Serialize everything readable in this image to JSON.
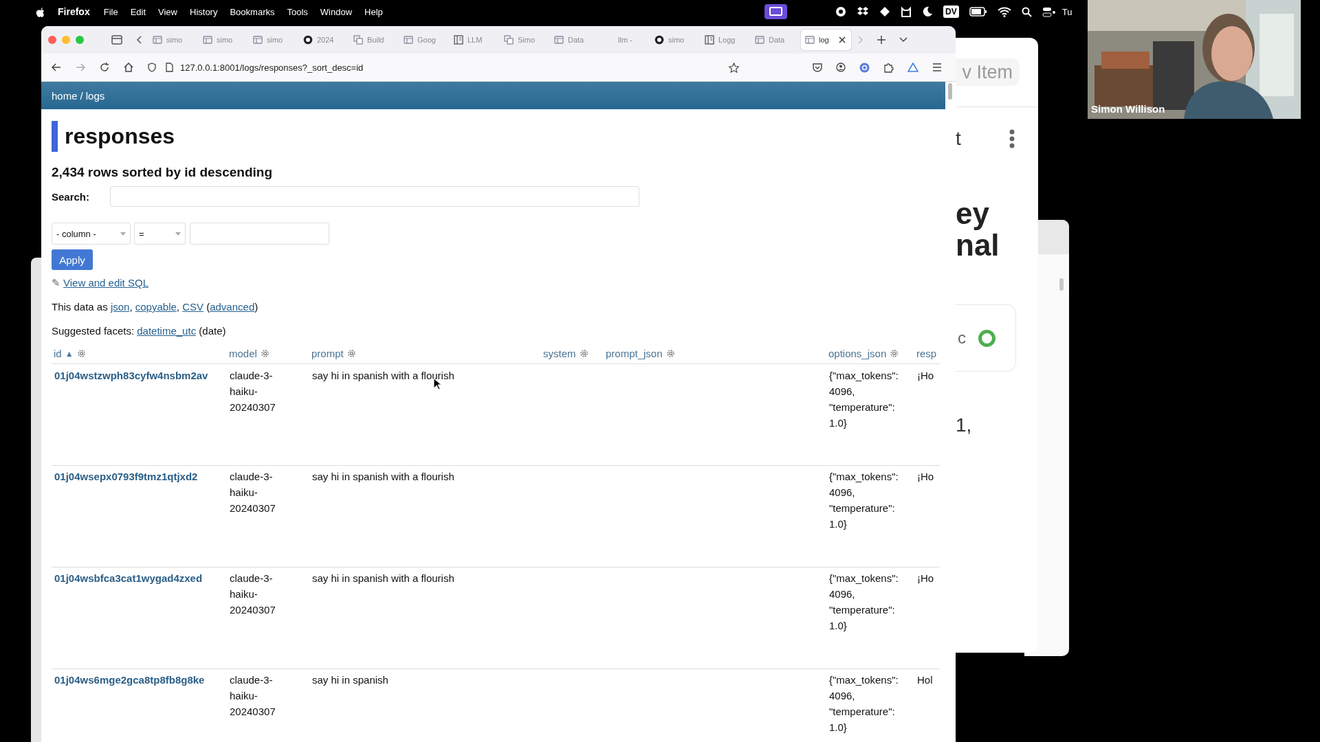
{
  "menubar": {
    "app": "Firefox",
    "menus": [
      "File",
      "Edit",
      "View",
      "History",
      "Bookmarks",
      "Tools",
      "Window",
      "Help"
    ],
    "badge": "DV",
    "clock": "Tu"
  },
  "browser": {
    "tabs": [
      {
        "label": "simo",
        "kind": "page",
        "selected": false
      },
      {
        "label": "simo",
        "kind": "page",
        "selected": false
      },
      {
        "label": "simo",
        "kind": "page",
        "selected": false
      },
      {
        "label": "2024",
        "kind": "round",
        "selected": false
      },
      {
        "label": "Build",
        "kind": "pages",
        "selected": false
      },
      {
        "label": "Goog",
        "kind": "page",
        "selected": false
      },
      {
        "label": "LLM",
        "kind": "book",
        "selected": false
      },
      {
        "label": "Simo",
        "kind": "pages",
        "selected": false
      },
      {
        "label": "Data",
        "kind": "page",
        "selected": false
      },
      {
        "label": "llm -",
        "kind": "plain",
        "selected": false
      },
      {
        "label": "simo",
        "kind": "round",
        "selected": false
      },
      {
        "label": "Logg",
        "kind": "book",
        "selected": false
      },
      {
        "label": "Data",
        "kind": "page",
        "selected": false
      },
      {
        "label": "log",
        "kind": "page",
        "selected": true
      }
    ],
    "url": "127.0.0.1:8001/logs/responses?_sort_desc=id"
  },
  "page": {
    "breadcrumb": {
      "links": [
        "home",
        "logs"
      ],
      "separator": "/"
    },
    "title": "responses",
    "summary": "2,434 rows sorted by id descending",
    "search": {
      "label": "Search:"
    },
    "filter": {
      "column": "- column -",
      "operator": "="
    },
    "apply": "Apply",
    "sql_link": {
      "icon": "✎",
      "text": "View and edit SQL"
    },
    "export": [
      {
        "kind": "text",
        "text": "This data as "
      },
      {
        "kind": "link",
        "text": "json"
      },
      {
        "kind": "text",
        "text": ", "
      },
      {
        "kind": "link",
        "text": "copyable"
      },
      {
        "kind": "text",
        "text": ", "
      },
      {
        "kind": "link",
        "text": "CSV"
      },
      {
        "kind": "text",
        "text": " ("
      },
      {
        "kind": "link",
        "text": "advanced"
      },
      {
        "kind": "text",
        "text": ")"
      }
    ],
    "facets": [
      {
        "kind": "text",
        "text": "Suggested facets: "
      },
      {
        "kind": "link",
        "text": "datetime_utc"
      },
      {
        "kind": "text",
        "text": " (date)"
      }
    ],
    "table": {
      "columns": [
        {
          "label": "id",
          "sort_arrow": "▲",
          "menu": true
        },
        {
          "label": "model",
          "menu": true
        },
        {
          "label": "prompt",
          "menu": true
        },
        {
          "label": "system",
          "menu": true
        },
        {
          "label": "prompt_json",
          "menu": true
        },
        {
          "label": "options_json",
          "menu": true
        },
        {
          "label": "resp",
          "menu": false
        }
      ],
      "rows": [
        {
          "cells": [
            "01j04wstzwph83cyfw4nsbm2av",
            "claude-3-haiku-20240307",
            "say hi in spanish with a flourish",
            null,
            null,
            "{\"max_tokens\": 4096, \"temperature\": 1.0}",
            "¡Ho"
          ]
        },
        {
          "cells": [
            "01j04wsepx0793f9tmz1qtjxd2",
            "claude-3-haiku-20240307",
            "say hi in spanish with a flourish",
            null,
            null,
            "{\"max_tokens\": 4096, \"temperature\": 1.0}",
            "¡Ho"
          ]
        },
        {
          "cells": [
            "01j04wsbfca3cat1wygad4zxed",
            "claude-3-haiku-20240307",
            "say hi in spanish with a flourish",
            null,
            null,
            "{\"max_tokens\": 4096, \"temperature\": 1.0}",
            "¡Ho"
          ]
        },
        {
          "cells": [
            "01j04ws6mge2gca8tp8fb8g8ke",
            "claude-3-haiku-20240307",
            "say hi in spanish",
            null,
            null,
            "{\"max_tokens\": 4096, \"temperature\": 1.0}",
            "Hol"
          ]
        }
      ]
    }
  },
  "side_window": {
    "button": "v Item",
    "title": "t",
    "heading": [
      "ey",
      "nal"
    ],
    "status": "c",
    "text": "1,"
  },
  "webcam": {
    "name": "Simon Willison"
  }
}
